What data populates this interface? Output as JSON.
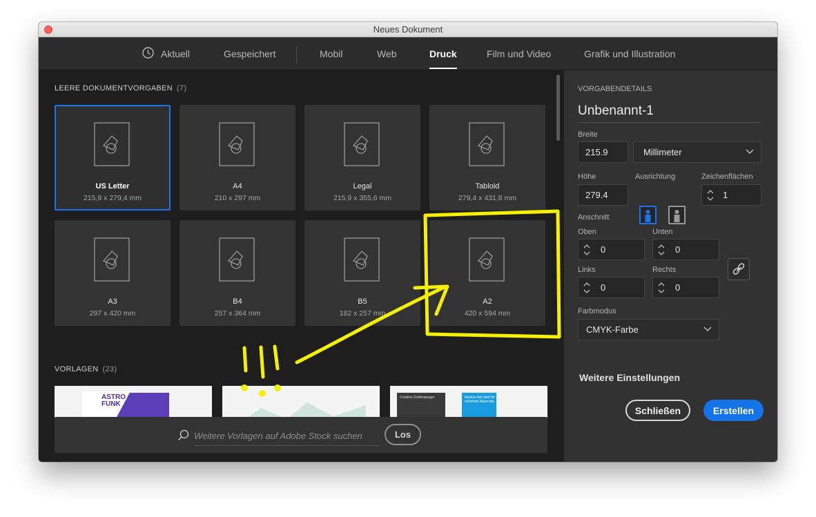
{
  "window": {
    "title": "Neues Dokument"
  },
  "tabs": [
    {
      "label": "Aktuell",
      "icon": "clock-icon"
    },
    {
      "label": "Gespeichert"
    },
    {
      "label": "Mobil"
    },
    {
      "label": "Web"
    },
    {
      "label": "Druck",
      "active": true
    },
    {
      "label": "Film und Video"
    },
    {
      "label": "Grafik und Illustration"
    }
  ],
  "presets_section": {
    "title": "LEERE DOKUMENTVORGABEN",
    "count": "(7)"
  },
  "presets": [
    {
      "name": "US Letter",
      "size": "215,9 x 279,4 mm",
      "selected": true
    },
    {
      "name": "A4",
      "size": "210 x 297 mm"
    },
    {
      "name": "Legal",
      "size": "215,9 x 355,6 mm"
    },
    {
      "name": "Tabloid",
      "size": "279,4 x 431,8 mm"
    },
    {
      "name": "A3",
      "size": "297 x 420 mm"
    },
    {
      "name": "B4",
      "size": "257 x 364 mm"
    },
    {
      "name": "B5",
      "size": "182 x 257 mm"
    },
    {
      "name": "A2",
      "size": "420 x 594 mm"
    }
  ],
  "templates_section": {
    "title": "VORLAGEN",
    "count": "(23)"
  },
  "templates": [
    {
      "text": "ASTRO FUNK"
    },
    {
      "text": ""
    },
    {
      "text": "Creative Goldmanager",
      "text2": "Markus hier jetzt für schickste Absender"
    }
  ],
  "search": {
    "placeholder": "Weitere Vorlagen auf Adobe Stock suchen",
    "button": "Los"
  },
  "details": {
    "section_title": "VORGABENDETAILS",
    "doc_name": "Unbenannt-1",
    "width_label": "Breite",
    "width_value": "215.9",
    "unit_value": "Millimeter",
    "height_label": "Höhe",
    "height_value": "279.4",
    "orientation_label": "Ausrichtung",
    "artboards_label": "Zeichenflächen",
    "artboards_value": "1",
    "bleed_label": "Anschnitt",
    "top_label": "Oben",
    "top_value": "0",
    "bottom_label": "Unten",
    "bottom_value": "0",
    "left_label": "Links",
    "left_value": "0",
    "right_label": "Rechts",
    "right_value": "0",
    "color_mode_label": "Farbmodus",
    "color_mode_value": "CMYK-Farbe",
    "more_settings": "Weitere Einstellungen",
    "close_button": "Schließen",
    "create_button": "Erstellen"
  },
  "colors": {
    "accent": "#1473e6",
    "annotation": "#f5f000",
    "panel": "#323232",
    "background": "#1e1e1e"
  }
}
